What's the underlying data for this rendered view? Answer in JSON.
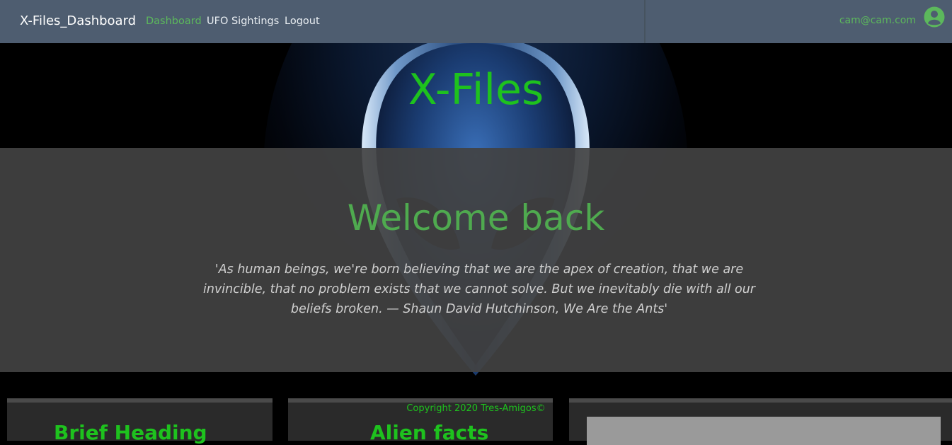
{
  "navbar": {
    "brand": "X-Files_Dashboard",
    "links": [
      {
        "label": "Dashboard",
        "active": true
      },
      {
        "label": "UFO Sightings",
        "active": false
      },
      {
        "label": "Logout",
        "active": false
      }
    ],
    "user_email": "cam@cam.com",
    "user_icon": "user-circle-icon"
  },
  "hero": {
    "title": "X-Files",
    "background": "alien-head-image"
  },
  "welcome": {
    "title": "Welcome back",
    "quote": "'As human beings, we're born believing that we are the apex of creation, that we are invincible, that no problem exists that we cannot solve. But we inevitably die with all our beliefs broken. — Shaun David Hutchinson, We Are the Ants'"
  },
  "cards": [
    {
      "heading": "Brief  Heading"
    },
    {
      "heading": "Alien  facts"
    },
    {
      "image": "card-image"
    }
  ],
  "footer": {
    "copyright": "Copyright 2020 Tres-Amigos©"
  },
  "colors": {
    "accent_green": "#1ec21e",
    "nav_bg": "#4e5d70",
    "band_bg": "#424242"
  }
}
